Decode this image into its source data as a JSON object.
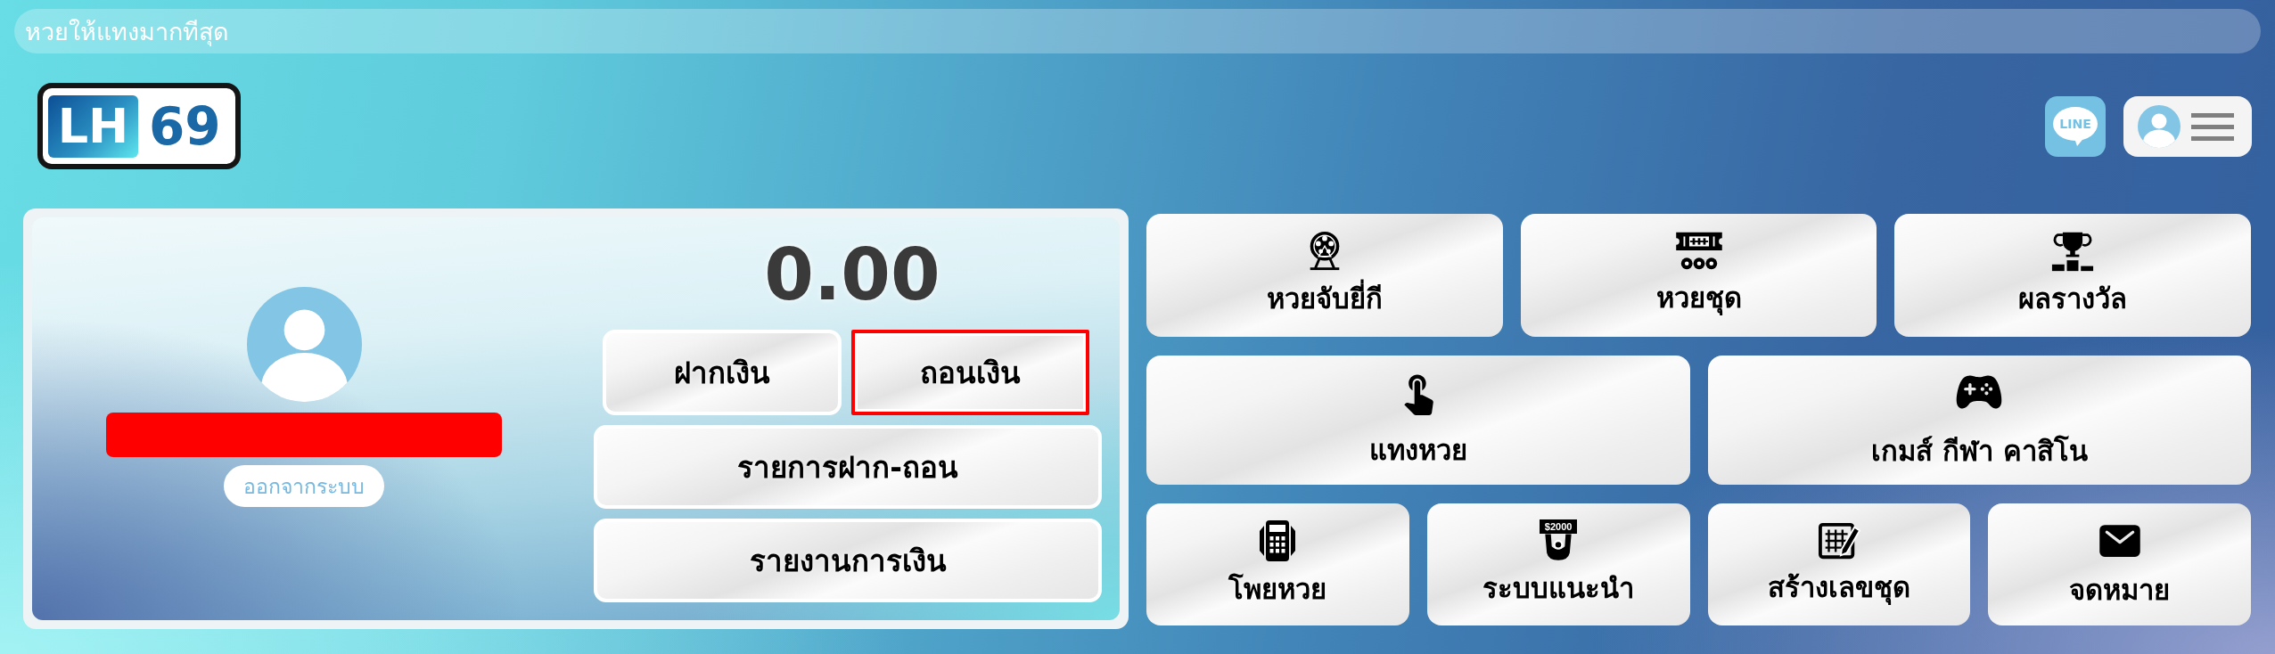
{
  "announcement": {
    "text": "หวยให้แทงมากทีสุด"
  },
  "header": {
    "logo": {
      "badge": "LH",
      "number": "69"
    },
    "line_button": {
      "label": "LINE"
    }
  },
  "account": {
    "logout_button": {
      "label": "ออกจากระบบ"
    },
    "balance": "0.00",
    "buttons": [
      {
        "label": "ฝากเงิน",
        "highlighted": false
      },
      {
        "label": "ถอนเงิน",
        "highlighted": true
      }
    ],
    "links": [
      {
        "label": "รายการฝาก-ถอน"
      },
      {
        "label": "รายงานการเงิน"
      }
    ]
  },
  "menu": {
    "rows": [
      {
        "tiles": [
          {
            "label": "หวยจับยี่กี"
          },
          {
            "label": "หวยชุด"
          },
          {
            "label": "ผลรางวัล"
          }
        ]
      },
      {
        "tiles": [
          {
            "label": "แทงหวย"
          },
          {
            "label": "เกมส์ กีฬา คาสิโน"
          }
        ]
      },
      {
        "tiles": [
          {
            "label": "โพยหวย"
          },
          {
            "label": "ระบบแนะนำ",
            "sign": "$2000"
          },
          {
            "label": "สร้างเลขชุด"
          },
          {
            "label": "จดหมาย"
          }
        ]
      }
    ]
  }
}
